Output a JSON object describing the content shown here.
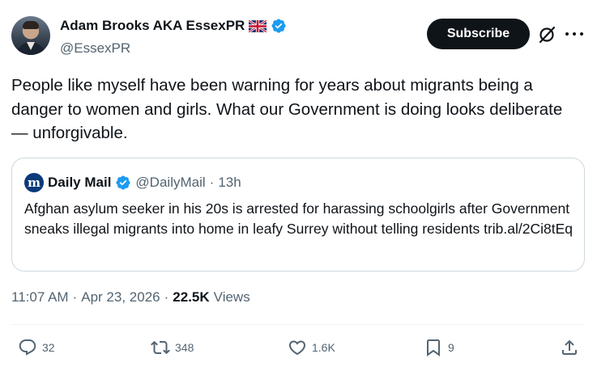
{
  "author": {
    "name": "Adam Brooks AKA EssexPR",
    "handle": "@EssexPR"
  },
  "subscribe_label": "Subscribe",
  "tweet_text": "People like myself have been warning for years about migrants being a danger to women and girls. What our Government is doing looks deliberate — unforgivable.",
  "quote": {
    "name": "Daily Mail",
    "handle": "@DailyMail",
    "separator": "·",
    "time": "13h",
    "logo_letter": "m",
    "text": "Afghan asylum seeker in his 20s is arrested for harassing schoolgirls after Government sneaks illegal migrants into home in leafy Surrey without telling residents trib.al/2Ci8tEq"
  },
  "meta": {
    "time": "11:07 AM",
    "sep1": "·",
    "date": "Apr 23, 2026",
    "sep2": "·",
    "views_count": "22.5K",
    "views_label": "Views"
  },
  "actions": {
    "replies": "32",
    "reposts": "348",
    "likes": "1.6K",
    "bookmarks": "9"
  },
  "icons": [
    "flag-uk-icon",
    "verified-badge-icon",
    "grok-icon",
    "more-icon",
    "reply-icon",
    "repost-icon",
    "like-icon",
    "bookmark-icon",
    "share-icon"
  ],
  "colors": {
    "accent": "#1d9bf0",
    "text": "#0f1419",
    "secondary": "#536471",
    "border": "#cfd9de"
  }
}
